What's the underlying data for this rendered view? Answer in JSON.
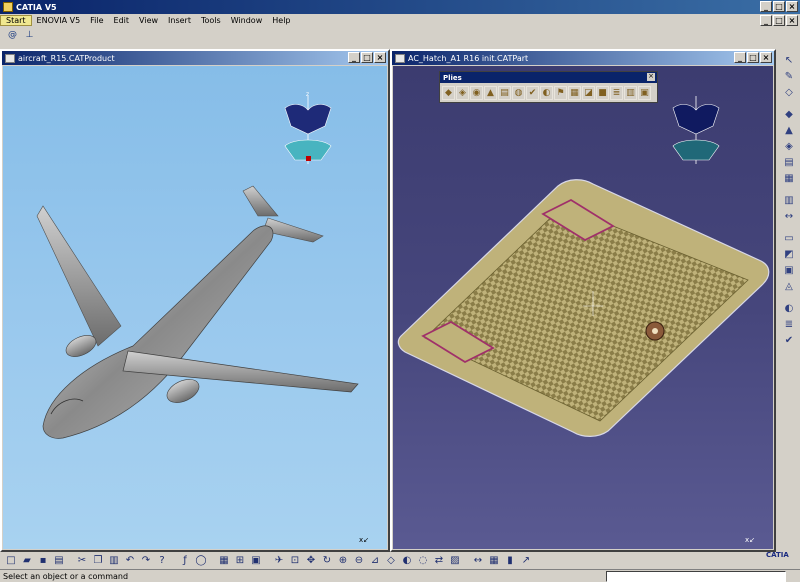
{
  "app": {
    "title": "CATIA V5"
  },
  "menu": [
    "Start",
    "ENOVIA V5",
    "File",
    "Edit",
    "View",
    "Insert",
    "Tools",
    "Window",
    "Help"
  ],
  "left_window": {
    "title": "aircraft_R15.CATProduct"
  },
  "right_window": {
    "title": "AC_Hatch_A1 R16 init.CATPart"
  },
  "plies_toolbar": {
    "title": "Plies"
  },
  "compass_label": "z",
  "status": {
    "message": "Select an object or a command"
  },
  "logo": "CATIA",
  "colors": {
    "title_bar": "#0a246a",
    "left_bg": "#9ccaee",
    "right_bg": "#46467c",
    "part_surface": "#bfb27a",
    "ply_outline": "#a0306a"
  },
  "icons": {
    "toolbar2": [
      "spiral-icon",
      "axis-icon"
    ],
    "right_toolbar": [
      "arrow-icon",
      "sketch-icon",
      "plane-icon",
      "solid-icon",
      "shape-icon",
      "ply-icon",
      "stack-icon",
      "grid-icon",
      "table-icon",
      "measure-icon",
      "sheet-icon",
      "fold-icon",
      "export-icon",
      "analysis-icon"
    ],
    "bottom_toolbar": [
      "new-icon",
      "open-icon",
      "save-icon",
      "print-icon",
      "cut-icon",
      "copy-icon",
      "paste-icon",
      "undo-icon",
      "redo-icon",
      "help-icon",
      "formula-icon",
      "comment-icon",
      "table-icon",
      "tree-icon",
      "catalog-icon",
      "fly-icon",
      "fit-icon",
      "pan-icon",
      "rotate-icon",
      "zoom-in-icon",
      "zoom-out-icon",
      "normal-view-icon",
      "iso-view-icon",
      "render-icon",
      "hide-icon",
      "swap-icon",
      "cube-icon",
      "measure-icon",
      "save-mgmt-icon",
      "lock-icon",
      "select-icon"
    ]
  }
}
